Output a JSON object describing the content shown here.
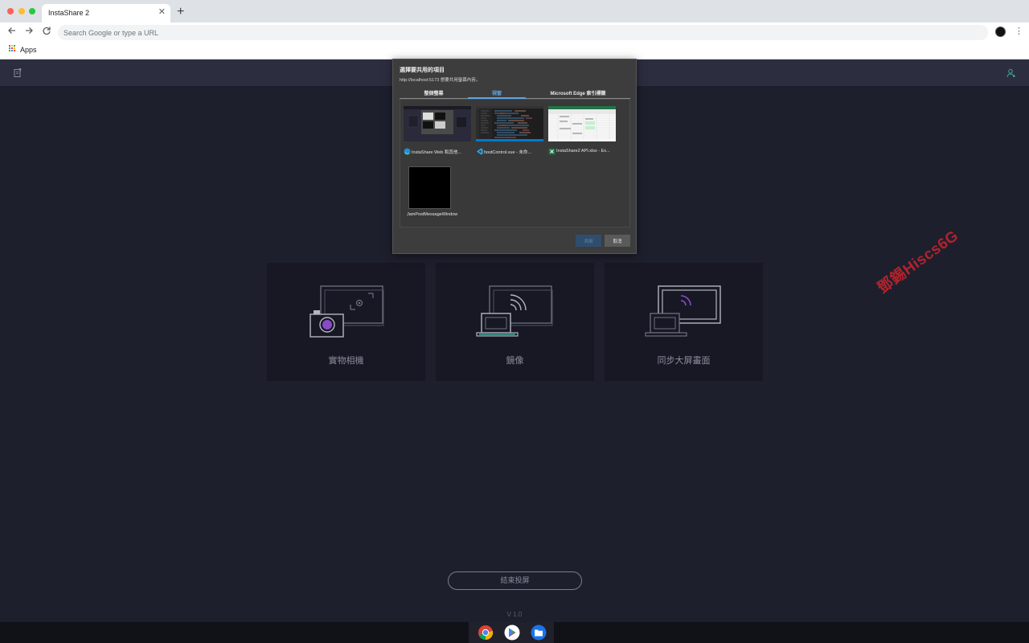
{
  "browser": {
    "tab_title": "InstaShare 2",
    "tab_close": "✕",
    "new_tab": "+",
    "address_placeholder": "Search Google or type a URL",
    "bookmarks_apps": "Apps",
    "menu_icon": "⋮"
  },
  "app": {
    "cards": [
      {
        "label": "實物相機",
        "icon": "document-camera-icon"
      },
      {
        "label": "鏡像",
        "icon": "screen-mirror-icon"
      },
      {
        "label": "同步大屏畫面",
        "icon": "sync-screen-icon"
      }
    ],
    "end_button": "結束投屏",
    "version": "V 1.0",
    "watermark": "鄧錫Hiscs6G",
    "colors": {
      "background": "#1e1f2d",
      "header": "#2c2e40",
      "card": "#171824",
      "accent_purple": "#8b49c9",
      "accent_teal": "#3aa89a"
    }
  },
  "dialog": {
    "title": "選擇要共用的項目",
    "subtitle": "http://localhost:5173 想要共用螢幕內容。",
    "tabs": [
      "整個螢幕",
      "視窗",
      "Microsoft Edge 索引標籤"
    ],
    "active_tab": "視窗",
    "windows": [
      {
        "label": "InstaShare Web 和其他...",
        "icon": "edge-browser-icon"
      },
      {
        "label": "hostControl.vue - 未命...",
        "icon": "vscode-icon"
      },
      {
        "label": "InstaShare2 API.xlsx - Ex...",
        "icon": "excel-icon"
      },
      {
        "label": "JamPostMessageWindow",
        "icon": "none"
      }
    ],
    "share_button": "共用",
    "cancel_button": "取消"
  },
  "shelf": {
    "apps": [
      "chrome-icon",
      "play-store-icon",
      "files-icon"
    ]
  }
}
